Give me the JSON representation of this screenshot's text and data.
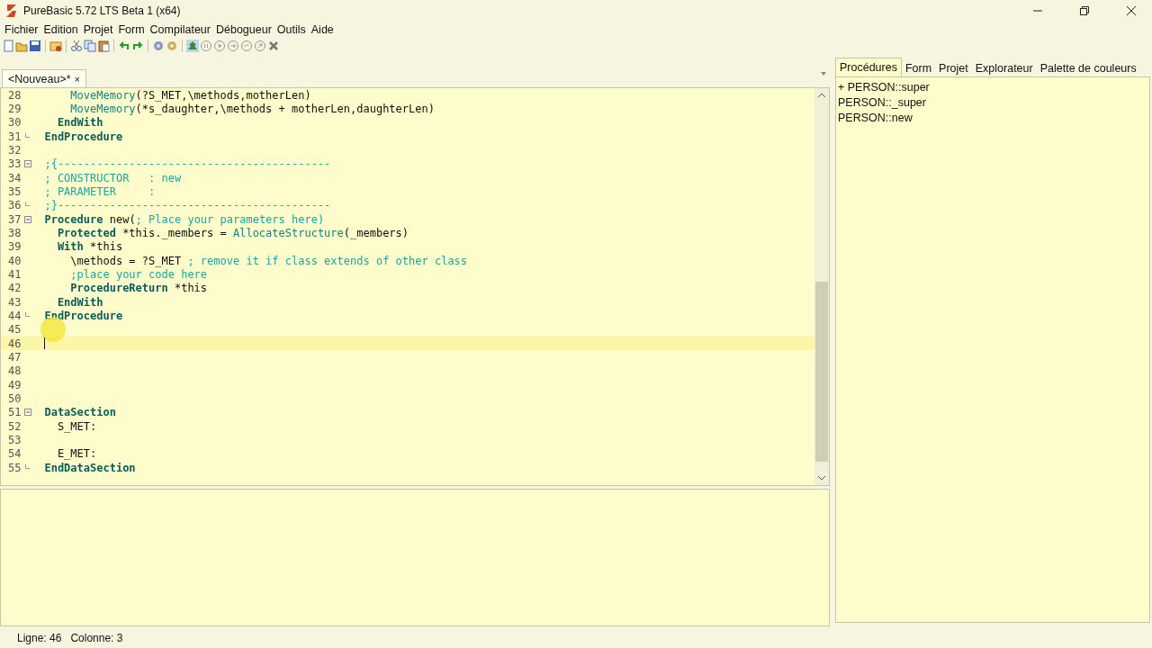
{
  "window": {
    "title": "PureBasic 5.72 LTS Beta 1 (x64)"
  },
  "menu": [
    "Fichier",
    "Edition",
    "Projet",
    "Form",
    "Compilateur",
    "Débogueur",
    "Outils",
    "Aide"
  ],
  "editor_tabs": [
    {
      "label": "<Nouveau>*",
      "close": "×",
      "selected": true
    }
  ],
  "code_lines": [
    {
      "number": "28",
      "fold_start": false,
      "fold_end": false,
      "current": false,
      "segments": [
        {
          "kind": "fn",
          "text": "      MoveMemory"
        },
        {
          "kind": "plain",
          "text": "(?S_MET,\\methods,motherLen)"
        }
      ]
    },
    {
      "number": "29",
      "fold_start": false,
      "fold_end": false,
      "current": false,
      "segments": [
        {
          "kind": "fn",
          "text": "      MoveMemory"
        },
        {
          "kind": "plain",
          "text": "(*s_daughter,\\methods + motherLen,daughterLen)"
        }
      ]
    },
    {
      "number": "30",
      "fold_start": false,
      "fold_end": false,
      "current": false,
      "segments": [
        {
          "kind": "kw",
          "text": "    EndWith"
        }
      ]
    },
    {
      "number": "31",
      "fold_start": false,
      "fold_end": true,
      "current": false,
      "segments": [
        {
          "kind": "kw",
          "text": "  EndProcedure"
        }
      ]
    },
    {
      "number": "32",
      "fold_start": false,
      "fold_end": false,
      "current": false
    },
    {
      "number": "33",
      "fold_start": true,
      "fold_end": false,
      "current": false,
      "segments": [
        {
          "kind": "cm",
          "text": "  ;{------------------------------------------"
        }
      ]
    },
    {
      "number": "34",
      "fold_start": false,
      "fold_end": false,
      "current": false,
      "segments": [
        {
          "kind": "cm",
          "text": "  ; CONSTRUCTOR   : new"
        }
      ]
    },
    {
      "number": "35",
      "fold_start": false,
      "fold_end": false,
      "current": false,
      "segments": [
        {
          "kind": "cm",
          "text": "  ; PARAMETER     :"
        }
      ]
    },
    {
      "number": "36",
      "fold_start": false,
      "fold_end": true,
      "current": false,
      "segments": [
        {
          "kind": "cm",
          "text": "  ;}------------------------------------------"
        }
      ]
    },
    {
      "number": "37",
      "fold_start": true,
      "fold_end": false,
      "current": false,
      "segments": [
        {
          "kind": "kw",
          "text": "  Procedure"
        },
        {
          "kind": "plain",
          "text": " new("
        },
        {
          "kind": "cm",
          "text": "; Place your parameters here)"
        }
      ]
    },
    {
      "number": "38",
      "fold_start": false,
      "fold_end": false,
      "current": false,
      "segments": [
        {
          "kind": "kw",
          "text": "    Protected"
        },
        {
          "kind": "plain",
          "text": " *this._members = "
        },
        {
          "kind": "fn",
          "text": "AllocateStructure"
        },
        {
          "kind": "plain",
          "text": "(_members)"
        }
      ]
    },
    {
      "number": "39",
      "fold_start": false,
      "fold_end": false,
      "current": false,
      "segments": [
        {
          "kind": "kw",
          "text": "    With"
        },
        {
          "kind": "plain",
          "text": " *this"
        }
      ]
    },
    {
      "number": "40",
      "fold_start": false,
      "fold_end": false,
      "current": false,
      "segments": [
        {
          "kind": "plain",
          "text": "      \\methods = ?S_MET "
        },
        {
          "kind": "cm",
          "text": "; remove it if class extends of other class"
        }
      ]
    },
    {
      "number": "41",
      "fold_start": false,
      "fold_end": false,
      "current": false,
      "segments": [
        {
          "kind": "cm",
          "text": "      ;place your code here"
        }
      ]
    },
    {
      "number": "42",
      "fold_start": false,
      "fold_end": false,
      "current": false,
      "segments": [
        {
          "kind": "kw",
          "text": "      ProcedureReturn"
        },
        {
          "kind": "plain",
          "text": " *this"
        }
      ]
    },
    {
      "number": "43",
      "fold_start": false,
      "fold_end": false,
      "current": false,
      "segments": [
        {
          "kind": "kw",
          "text": "    EndWith"
        }
      ]
    },
    {
      "number": "44",
      "fold_start": false,
      "fold_end": true,
      "current": false,
      "segments": [
        {
          "kind": "kw",
          "text": "  EndProcedure"
        }
      ]
    },
    {
      "number": "45",
      "fold_start": false,
      "fold_end": false,
      "current": false
    },
    {
      "number": "46",
      "fold_start": false,
      "fold_end": false,
      "current": true
    },
    {
      "number": "47",
      "fold_start": false,
      "fold_end": false,
      "current": false
    },
    {
      "number": "48",
      "fold_start": false,
      "fold_end": false,
      "current": false
    },
    {
      "number": "49",
      "fold_start": false,
      "fold_end": false,
      "current": false
    },
    {
      "number": "50",
      "fold_start": false,
      "fold_end": false,
      "current": false
    },
    {
      "number": "51",
      "fold_start": true,
      "fold_end": false,
      "current": false,
      "segments": [
        {
          "kind": "kw",
          "text": "  DataSection"
        }
      ]
    },
    {
      "number": "52",
      "fold_start": false,
      "fold_end": false,
      "current": false,
      "segments": [
        {
          "kind": "plain",
          "text": "    S_MET:"
        }
      ]
    },
    {
      "number": "53",
      "fold_start": false,
      "fold_end": false,
      "current": false
    },
    {
      "number": "54",
      "fold_start": false,
      "fold_end": false,
      "current": false,
      "segments": [
        {
          "kind": "plain",
          "text": "    E_MET:"
        }
      ]
    },
    {
      "number": "55",
      "fold_start": false,
      "fold_end": true,
      "current": false,
      "segments": [
        {
          "kind": "kw",
          "text": "  EndDataSection"
        }
      ]
    }
  ],
  "side_tabs": [
    {
      "label": "Procédures",
      "selected": true
    },
    {
      "label": "Form",
      "selected": false
    },
    {
      "label": "Projet",
      "selected": false
    },
    {
      "label": "Explorateur",
      "selected": false
    },
    {
      "label": "Palette de couleurs",
      "selected": false
    }
  ],
  "procedures": [
    "+ PERSON::super",
    "PERSON::_super",
    "PERSON::new"
  ],
  "status_bar": [
    "Ligne: 46",
    "Colonne: 3"
  ]
}
